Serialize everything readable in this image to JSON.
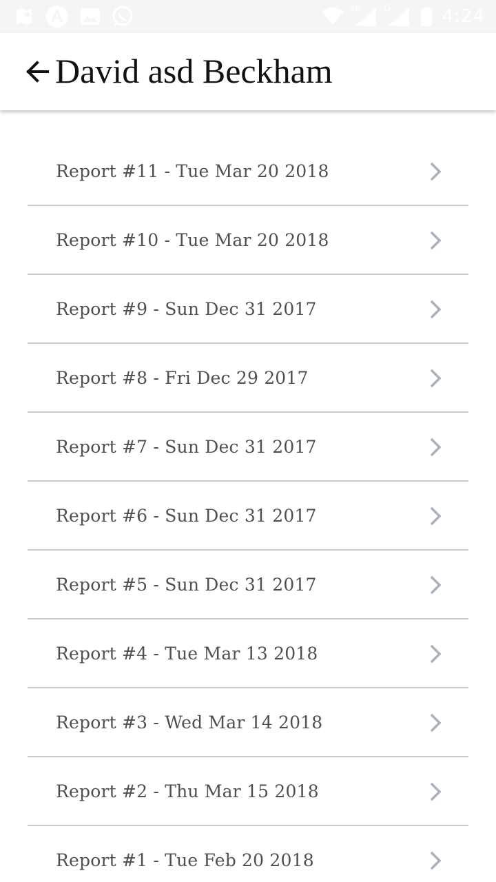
{
  "status_bar": {
    "time": "4:24",
    "network_label_1": "3G",
    "network_label_2": "G",
    "icons": [
      "maps-icon",
      "a-circle-icon",
      "image-icon",
      "whatsapp-icon",
      "wifi-icon",
      "signal-icon",
      "signal-icon",
      "battery-icon"
    ]
  },
  "header": {
    "title": "David asd Beckham",
    "back_icon": "arrow-left-icon"
  },
  "reports": [
    {
      "label": "Report #11 - Tue Mar 20 2018"
    },
    {
      "label": "Report #10 - Tue Mar 20 2018"
    },
    {
      "label": "Report #9 - Sun Dec 31 2017"
    },
    {
      "label": "Report #8 - Fri Dec 29 2017"
    },
    {
      "label": "Report #7 - Sun Dec 31 2017"
    },
    {
      "label": "Report #6 - Sun Dec 31 2017"
    },
    {
      "label": "Report #5 - Sun Dec 31 2017"
    },
    {
      "label": "Report #4 - Tue Mar 13 2018"
    },
    {
      "label": "Report #3 - Wed Mar 14 2018"
    },
    {
      "label": "Report #2 - Thu Mar 15 2018"
    },
    {
      "label": "Report #1 - Tue Feb 20 2018"
    }
  ],
  "colors": {
    "text": "#4f4f4f",
    "divider": "#c9cacc",
    "chevron": "#a9b2bc",
    "title": "#111111"
  }
}
